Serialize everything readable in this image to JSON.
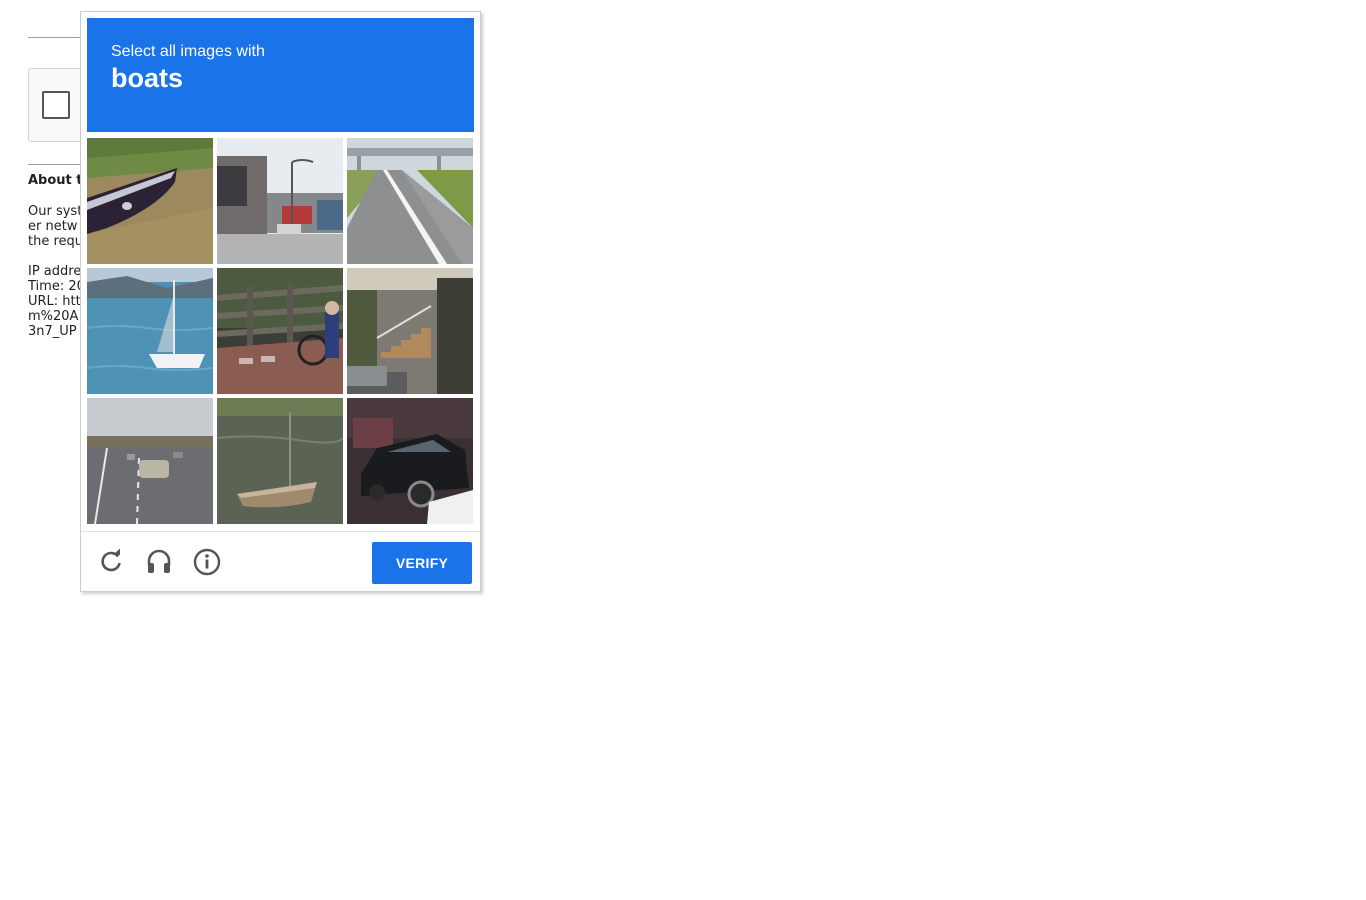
{
  "background": {
    "about_heading": "About t",
    "paragraph_lines": [
      "Our syst",
      "er netw",
      "the requ"
    ],
    "info_lines": [
      "IP addre",
      "Time: 20",
      "URL: htt",
      "m%20A",
      "3n7_UP"
    ]
  },
  "challenge": {
    "instruction": "Select all images with",
    "target": "boats",
    "tiles": [
      {
        "icon": "boat-on-grass-image"
      },
      {
        "icon": "storefront-street-image"
      },
      {
        "icon": "highway-road-image"
      },
      {
        "icon": "sailboat-on-lake-image"
      },
      {
        "icon": "cyclist-fence-image"
      },
      {
        "icon": "stairs-building-image"
      },
      {
        "icon": "highway-cars-image"
      },
      {
        "icon": "rowboat-in-water-image"
      },
      {
        "icon": "black-car-image"
      }
    ],
    "footer": {
      "reload_icon": "reload-icon",
      "audio_icon": "headphones-icon",
      "info_icon": "info-icon",
      "verify_label": "VERIFY"
    }
  },
  "colors": {
    "accent": "#1a73e8",
    "footer_icon": "#555555"
  }
}
